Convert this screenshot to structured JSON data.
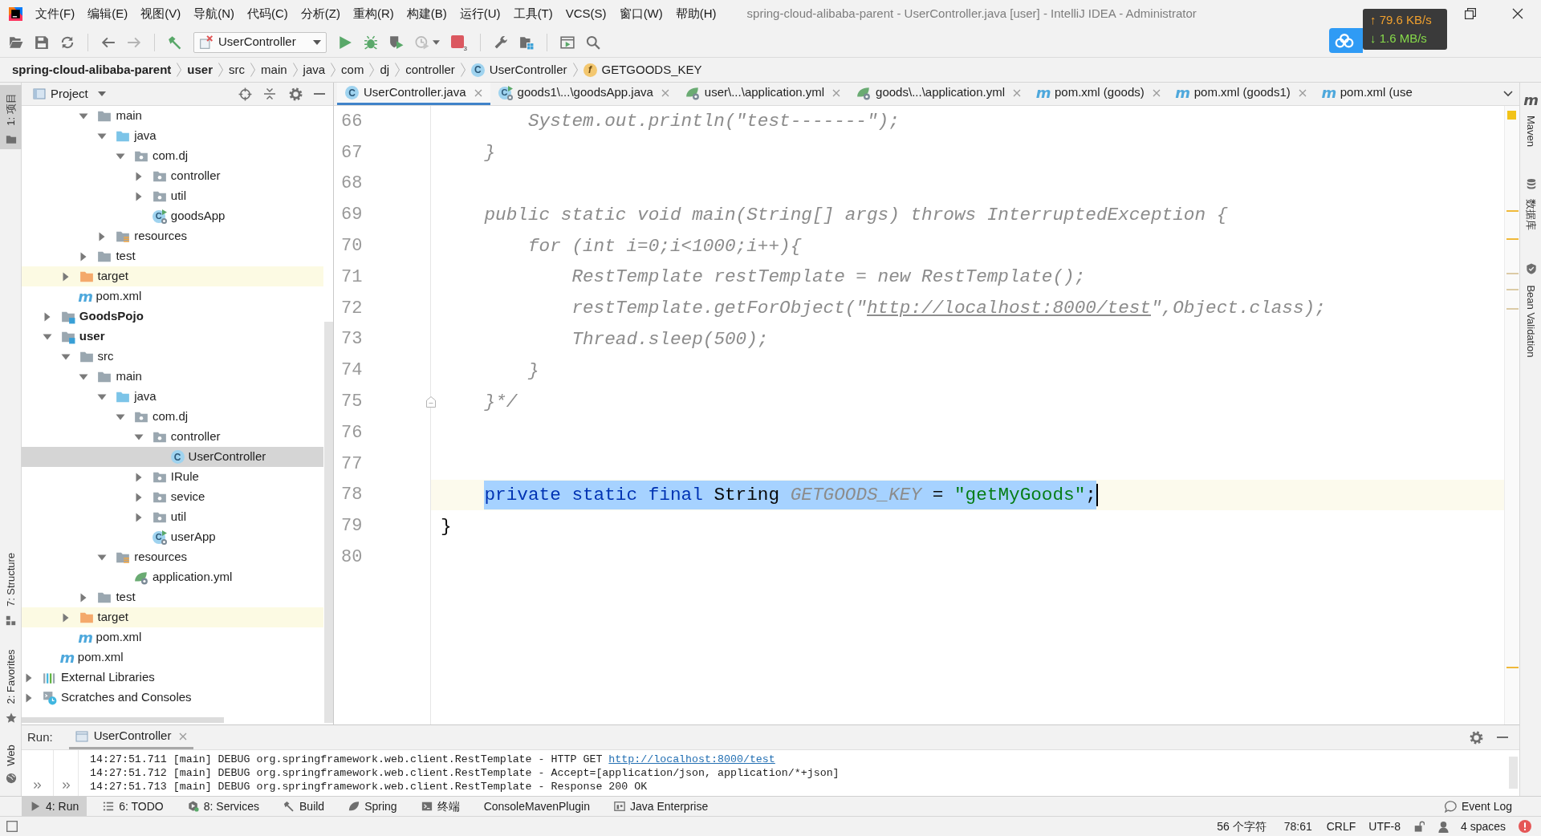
{
  "title_bar": {
    "menus": [
      "文件(F)",
      "编辑(E)",
      "视图(V)",
      "导航(N)",
      "代码(C)",
      "分析(Z)",
      "重构(R)",
      "构建(B)",
      "运行(U)",
      "工具(T)",
      "VCS(S)",
      "窗口(W)",
      "帮助(H)"
    ],
    "title": "spring-cloud-alibaba-parent - UserController.java [user] - IntelliJ IDEA - Administrator"
  },
  "network_monitor": {
    "upload": "↑ 79.6 KB/s",
    "download": "↓ 1.6 MB/s"
  },
  "toolbar": {
    "run_config": "UserController",
    "stop_badge": "3"
  },
  "breadcrumbs": [
    {
      "label": "spring-cloud-alibaba-parent",
      "kind": "module"
    },
    {
      "label": "user",
      "kind": "module"
    },
    {
      "label": "src",
      "kind": "folder"
    },
    {
      "label": "main",
      "kind": "folder"
    },
    {
      "label": "java",
      "kind": "folder"
    },
    {
      "label": "com",
      "kind": "folder"
    },
    {
      "label": "dj",
      "kind": "folder"
    },
    {
      "label": "controller",
      "kind": "folder"
    },
    {
      "label": "UserController",
      "kind": "class",
      "glyph": "C"
    },
    {
      "label": "GETGOODS_KEY",
      "kind": "field",
      "glyph": "f"
    }
  ],
  "left_tool_strip": {
    "top": [
      {
        "label": "1: 项目",
        "kind": "project",
        "selected": true
      }
    ],
    "bottom": [
      {
        "label": "7: Structure",
        "kind": "structure",
        "selected": false
      },
      {
        "label": "2: Favorites",
        "kind": "favorites",
        "selected": false
      },
      {
        "label": "Web",
        "kind": "web",
        "selected": false
      }
    ]
  },
  "project_panel": {
    "title": "Project",
    "tree": [
      {
        "children": [
          {
            "children": [
              {
                "children": [
                  {
                    "label": "main",
                    "kind": "folder",
                    "expanded": true,
                    "selected": false,
                    "children": [
                      {
                        "label": "java",
                        "kind": "source",
                        "expanded": true,
                        "selected": false,
                        "children": [
                          {
                            "label": "com.dj",
                            "kind": "package",
                            "expanded": true,
                            "selected": false,
                            "children": [
                              {
                                "label": "controller",
                                "kind": "package",
                                "expanded": false,
                                "selected": false
                              },
                              {
                                "label": "util",
                                "kind": "package",
                                "expanded": false,
                                "selected": false
                              },
                              {
                                "label": "goodsApp",
                                "kind": "app",
                                "glyph": "C",
                                "selected": false
                              }
                            ]
                          }
                        ]
                      },
                      {
                        "label": "resources",
                        "kind": "resources",
                        "expanded": false,
                        "selected": false
                      }
                    ]
                  },
                  {
                    "label": "test",
                    "kind": "folder",
                    "expanded": false,
                    "selected": false
                  }
                ]
              },
              {
                "label": "target",
                "kind": "excluded",
                "expanded": false,
                "selected": false
              },
              {
                "label": "pom.xml",
                "kind": "maven",
                "glyph": "m",
                "selected": false
              }
            ]
          },
          {
            "label": "GoodsPojo",
            "kind": "module",
            "expanded": false,
            "selected": false
          },
          {
            "label": "user",
            "kind": "module",
            "expanded": true,
            "selected": false,
            "children": [
              {
                "label": "src",
                "kind": "folder",
                "expanded": true,
                "selected": false,
                "children": [
                  {
                    "label": "main",
                    "kind": "folder",
                    "expanded": true,
                    "selected": false,
                    "children": [
                      {
                        "label": "java",
                        "kind": "source",
                        "expanded": true,
                        "selected": false,
                        "children": [
                          {
                            "label": "com.dj",
                            "kind": "package",
                            "expanded": true,
                            "selected": false,
                            "children": [
                              {
                                "label": "controller",
                                "kind": "package",
                                "expanded": true,
                                "selected": false,
                                "children": [
                                  {
                                    "label": "UserController",
                                    "kind": "class",
                                    "glyph": "C",
                                    "selected": true
                                  }
                                ]
                              },
                              {
                                "label": "IRule",
                                "kind": "package",
                                "expanded": false,
                                "selected": false
                              },
                              {
                                "label": "sevice",
                                "kind": "package",
                                "expanded": false,
                                "selected": false
                              },
                              {
                                "label": "util",
                                "kind": "package",
                                "expanded": false,
                                "selected": false
                              },
                              {
                                "label": "userApp",
                                "kind": "app",
                                "glyph": "C",
                                "selected": false
                              }
                            ]
                          }
                        ]
                      },
                      {
                        "label": "resources",
                        "kind": "resources",
                        "expanded": true,
                        "selected": false,
                        "children": [
                          {
                            "label": "application.yml",
                            "kind": "yml",
                            "selected": false
                          }
                        ]
                      }
                    ]
                  },
                  {
                    "label": "test",
                    "kind": "folder",
                    "expanded": false,
                    "selected": false
                  }
                ]
              },
              {
                "label": "target",
                "kind": "excluded",
                "expanded": false,
                "selected": false
              },
              {
                "label": "pom.xml",
                "kind": "maven",
                "glyph": "m",
                "selected": false
              }
            ]
          },
          {
            "label": "pom.xml",
            "kind": "maven",
            "glyph": "m",
            "selected": false
          }
        ]
      },
      {
        "label": "External Libraries",
        "kind": "libraries",
        "expanded": false,
        "selected": false
      },
      {
        "label": "Scratches and Consoles",
        "kind": "scratches",
        "expanded": false,
        "selected": false
      }
    ]
  },
  "editor_tabs": [
    {
      "label": "UserController.java",
      "kind": "class",
      "glyph": "C",
      "selected": true,
      "closable": true
    },
    {
      "label": "goods1\\...\\goodsApp.java",
      "kind": "app",
      "glyph": "C",
      "selected": false,
      "closable": true
    },
    {
      "label": "user\\...\\application.yml",
      "kind": "yml",
      "selected": false,
      "closable": true
    },
    {
      "label": "goods\\...\\application.yml",
      "kind": "yml",
      "selected": false,
      "closable": true
    },
    {
      "label": "pom.xml (goods)",
      "kind": "maven",
      "glyph": "m",
      "selected": false,
      "closable": true
    },
    {
      "label": "pom.xml (goods1)",
      "kind": "maven",
      "glyph": "m",
      "selected": false,
      "closable": true
    },
    {
      "label": "pom.xml (use",
      "kind": "maven",
      "glyph": "m",
      "selected": false,
      "closable": false
    }
  ],
  "editor": {
    "lines": [
      {
        "number": "66",
        "tokens": [
          {
            "text": "        System.out.println(\"test-------\");",
            "kind": "comment"
          }
        ],
        "current": false,
        "selection": false,
        "fold": false
      },
      {
        "number": "67",
        "tokens": [
          {
            "text": "    }",
            "kind": "comment"
          }
        ],
        "current": false,
        "selection": false,
        "fold": false
      },
      {
        "number": "68",
        "current": false,
        "fold": false
      },
      {
        "number": "69",
        "tokens": [
          {
            "text": "    public static void main(String[] args) throws InterruptedException {",
            "kind": "comment"
          }
        ],
        "current": false,
        "selection": false,
        "fold": false
      },
      {
        "number": "70",
        "tokens": [
          {
            "text": "        for (int i=0;i<1000;i++){",
            "kind": "comment"
          }
        ],
        "current": false,
        "selection": false,
        "fold": false
      },
      {
        "number": "71",
        "tokens": [
          {
            "text": "            RestTemplate restTemplate = new RestTemplate();",
            "kind": "comment"
          }
        ],
        "current": false,
        "selection": false,
        "fold": false
      },
      {
        "number": "72",
        "tokens": [
          {
            "text": "            restTemplate.getForObject(\"",
            "kind": "comment"
          },
          {
            "text": "http://localhost:8000/test",
            "kind": "comment-link"
          },
          {
            "text": "\",Object.class);",
            "kind": "comment"
          }
        ],
        "current": false,
        "selection": false,
        "fold": false
      },
      {
        "number": "73",
        "tokens": [
          {
            "text": "            Thread.sleep(500);",
            "kind": "comment"
          }
        ],
        "current": false,
        "selection": false,
        "fold": false
      },
      {
        "number": "74",
        "tokens": [
          {
            "text": "        }",
            "kind": "comment"
          }
        ],
        "current": false,
        "selection": false,
        "fold": false
      },
      {
        "number": "75",
        "tokens": [
          {
            "text": "    }*/",
            "kind": "comment"
          }
        ],
        "current": false,
        "selection": false,
        "fold": true
      },
      {
        "number": "76",
        "current": false,
        "fold": false
      },
      {
        "number": "77",
        "current": false,
        "fold": false
      },
      {
        "number": "78",
        "tokens": [
          {
            "text": "    private static final ",
            "kind": "keyword"
          },
          {
            "text": "String ",
            "kind": "plain"
          },
          {
            "text": "GETGOODS_KEY",
            "kind": "unused"
          },
          {
            "text": " = ",
            "kind": "plain"
          },
          {
            "text": "\"getMyGoods\"",
            "kind": "string"
          },
          {
            "text": ";",
            "kind": "plain"
          }
        ],
        "current": true,
        "selection": true,
        "fold": false
      },
      {
        "number": "79",
        "tokens": [
          {
            "text": "}",
            "kind": "plain"
          }
        ],
        "current": false,
        "selection": false,
        "fold": false
      },
      {
        "number": "80",
        "current": false,
        "fold": false
      }
    ]
  },
  "right_tool_strip": [
    {
      "label": "Maven",
      "kind": "maven",
      "glyph": "m",
      "selected": false
    },
    {
      "label": "数据库",
      "kind": "database",
      "selected": false
    },
    {
      "label": "Bean Validation",
      "kind": "bean",
      "selected": false
    }
  ],
  "run_panel": {
    "label": "Run:",
    "tab": {
      "label": "UserController",
      "selected": true
    },
    "console": [
      {
        "text": "14:27:51.711 [main] DEBUG org.springframework.web.client.RestTemplate - HTTP GET ",
        "link": "http://localhost:8000/test"
      },
      {
        "text": "14:27:51.712 [main] DEBUG org.springframework.web.client.RestTemplate - Accept=[application/json, application/*+json]"
      },
      {
        "text": "14:27:51.713 [main] DEBUG org.springframework.web.client.RestTemplate - Response 200 OK"
      }
    ]
  },
  "bottom_tools": [
    {
      "label": "4: Run",
      "kind": "run",
      "selected": true
    },
    {
      "label": "6: TODO",
      "kind": "todo",
      "selected": false
    },
    {
      "label": "8: Services",
      "kind": "services",
      "selected": false
    },
    {
      "label": "Build",
      "kind": "build",
      "selected": false
    },
    {
      "label": "Spring",
      "kind": "spring",
      "selected": false
    },
    {
      "label": "终端",
      "kind": "terminal",
      "selected": false
    },
    {
      "label": "ConsoleMavenPlugin",
      "kind": "plugin",
      "selected": false
    },
    {
      "label": "Java Enterprise",
      "kind": "enterprise",
      "selected": false
    }
  ],
  "event_log": "Event Log",
  "status_bar": {
    "char_count": "56 个字符",
    "position": "78:61",
    "line_separator": "CRLF",
    "encoding": "UTF-8",
    "indent": "4 spaces"
  }
}
